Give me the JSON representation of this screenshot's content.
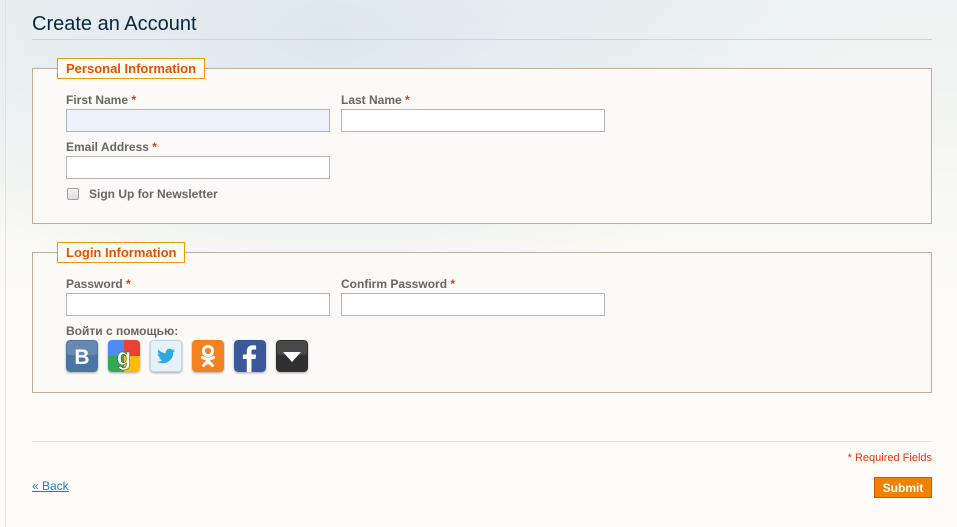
{
  "page": {
    "title": "Create an Account"
  },
  "personal": {
    "legend": "Personal Information",
    "first_name_label": "First Name",
    "last_name_label": "Last Name",
    "email_label": "Email Address",
    "required_mark": "*",
    "newsletter_label": "Sign Up for Newsletter",
    "first_name_value": "",
    "last_name_value": "",
    "email_value": ""
  },
  "login": {
    "legend": "Login Information",
    "password_label": "Password",
    "confirm_label": "Confirm Password",
    "required_mark": "*",
    "social_label": "Войти с помощью:",
    "password_value": "",
    "confirm_value": ""
  },
  "social_icons": [
    {
      "name": "vkontakte-icon",
      "glyph": "B",
      "color": "#4d75a3"
    },
    {
      "name": "google-icon",
      "glyph": "g",
      "color": "#3f9c35"
    },
    {
      "name": "twitter-icon",
      "glyph": "bird",
      "color": "#2da9e1"
    },
    {
      "name": "odnoklassniki-icon",
      "glyph": "ok",
      "color": "#f58220"
    },
    {
      "name": "facebook-icon",
      "glyph": "f",
      "color": "#3b5998"
    },
    {
      "name": "more-providers-icon",
      "glyph": "▼",
      "color": "#333333"
    }
  ],
  "footer": {
    "required_note": "* Required Fields",
    "back_label": "« Back",
    "submit_label": "Submit"
  },
  "colors": {
    "accent": "#f18200",
    "legend_text": "#e25203",
    "required": "#eb340a",
    "link": "#1e7ec8"
  }
}
